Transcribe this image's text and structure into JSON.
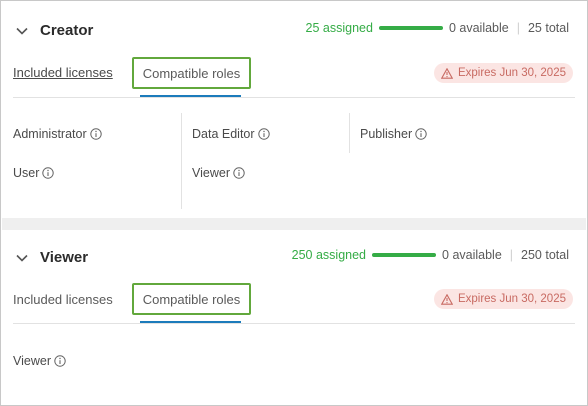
{
  "sections": [
    {
      "title": "Creator",
      "assigned": "25 assigned",
      "available": "0 available",
      "total": "25 total",
      "assigned_fraction": 1.0,
      "tabs": {
        "included": "Included licenses",
        "compatible": "Compatible roles"
      },
      "expires": "Expires Jun 30, 2025",
      "roles": [
        "Administrator",
        "Data Editor",
        "Publisher",
        "User",
        "Viewer"
      ]
    },
    {
      "title": "Viewer",
      "assigned": "250 assigned",
      "available": "0 available",
      "total": "250 total",
      "assigned_fraction": 1.0,
      "tabs": {
        "included": "Included licenses",
        "compatible": "Compatible roles"
      },
      "expires": "Expires Jun 30, 2025",
      "roles": [
        "Viewer"
      ]
    }
  ],
  "colors": {
    "accent_green": "#35ac46",
    "active_outline": "#62a83c",
    "tab_indicator": "#1c7bbb",
    "expires_bg": "#fbe5e3",
    "expires_text": "#c86a62"
  },
  "icons": {
    "collapse": "chevron-down-icon",
    "warning": "warning-triangle-icon",
    "info": "info-circle-icon"
  }
}
